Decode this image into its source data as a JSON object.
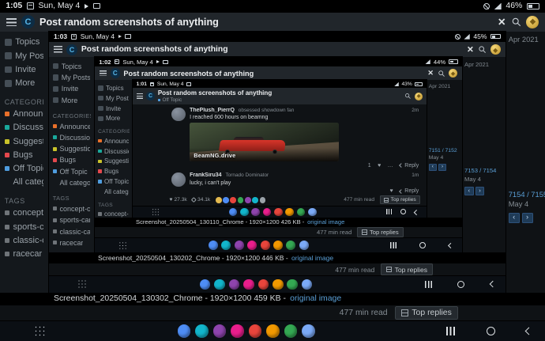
{
  "colors": {
    "link_blue": "#5a9fd6",
    "timeline_blue": "#5a9fd6",
    "header_bg": "#21262b",
    "page_bg": "#0f1215",
    "sidebar_bg": "#14181c",
    "avatar_gold": "#e3b94f",
    "logo_blue": "#57b6e8",
    "off_topic_blue": "#4f9ddf"
  },
  "shared": {
    "forum_logo_letter": "C",
    "close_label": "✕",
    "title": "Post random screenshots of anything",
    "sidebar": {
      "nav": [
        {
          "label": "Topics"
        },
        {
          "label": "My Posts"
        },
        {
          "label": "Invite"
        },
        {
          "label": "More"
        }
      ],
      "categories_heading": "CATEGORIES",
      "categories": [
        {
          "label": "Announcements",
          "color": "#e8702a"
        },
        {
          "label": "Discussion",
          "color": "#1aa99c"
        },
        {
          "label": "Suggestions",
          "color": "#c9c32a"
        },
        {
          "label": "Bugs",
          "color": "#e5484d"
        },
        {
          "label": "Off Topic",
          "color": "#4f9ddf"
        },
        {
          "label": "All categories",
          "color": "transparent"
        }
      ],
      "tags_heading": "TAGS",
      "tags": [
        {
          "label": "concept-car",
          "color": "#6f7479"
        },
        {
          "label": "sports-car",
          "color": "#6f7479"
        },
        {
          "label": "classic-car",
          "color": "#6f7479"
        },
        {
          "label": "racecar",
          "color": "#6f7479"
        }
      ]
    },
    "rail_top": "Apr 2021",
    "caption_link": "original image",
    "footer": {
      "read": "477 min read",
      "top_replies": "Top replies"
    },
    "taskbar_apps": [
      {
        "name": "app-1",
        "color": "#4e8df5"
      },
      {
        "name": "app-2",
        "color": "#12b5cb"
      },
      {
        "name": "app-3",
        "color": "#8e44ad"
      },
      {
        "name": "app-4",
        "color": "#e91e8c"
      },
      {
        "name": "app-5",
        "color": "#e8453c"
      },
      {
        "name": "app-6",
        "color": "#f29900"
      },
      {
        "name": "app-7",
        "color": "#34a853"
      },
      {
        "name": "app-8",
        "color": "#7baaf7"
      }
    ]
  },
  "layers": [
    {
      "time": "1:05",
      "date": "Sun, May 4",
      "battery": "46%",
      "rail_pos": "7154 / 7155",
      "rail_date": "May 4",
      "caption": "Screenshot_20250504_130302_Chrome - 1920×1200 459 KB -"
    },
    {
      "time": "1:03",
      "date": "Sun, May 4",
      "battery": "45%",
      "rail_pos": "7153 / 7154",
      "rail_date": "May 4",
      "caption": "Screenshot_20250504_130202_Chrome - 1920×1200 446 KB -"
    },
    {
      "time": "1:02",
      "date": "Sun, May 4",
      "battery": "44%",
      "rail_pos": "7151 / 7152",
      "rail_date": "May 4",
      "caption": "Screenshot_20250504_130110_Chrome - 1920×1200 426 KB -"
    },
    {
      "time": "1:01",
      "date": "Sun, May 4",
      "battery": "43%"
    }
  ],
  "thread": {
    "category": "Off Topic",
    "posts": [
      {
        "author": "ThePlush_PierrQ",
        "flair": "obsessed showdown fan",
        "time": "2m",
        "body": "I reached 600 hours on beamng",
        "image_label": "BeamNG.drive",
        "like_count": "1",
        "reply_label": "Reply"
      },
      {
        "author": "FrankSiru34",
        "flair": "Tornado Dominator",
        "time": "1m",
        "body": "lucky, i can't play",
        "reply_label": "Reply"
      }
    ],
    "stats": {
      "likes": "27.3k",
      "links": "34.1k"
    },
    "poster_avatars": [
      {
        "color": "#e3b94f"
      },
      {
        "color": "#4e8df5"
      },
      {
        "color": "#e8453c"
      },
      {
        "color": "#34a853"
      },
      {
        "color": "#8e44ad"
      },
      {
        "color": "#12b5cb"
      },
      {
        "color": "#9aa2a9"
      }
    ]
  }
}
